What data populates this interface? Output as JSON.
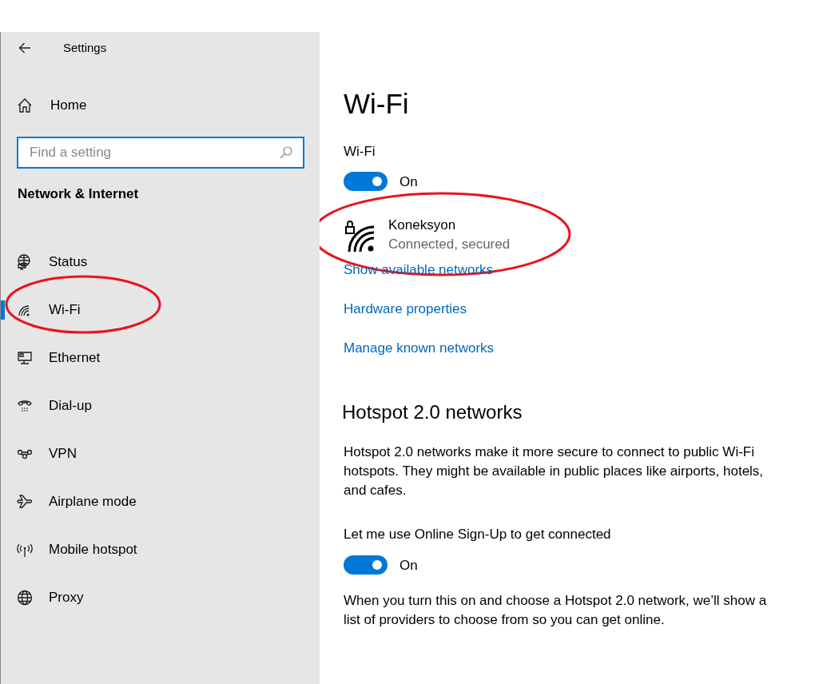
{
  "window": {
    "title": "Settings"
  },
  "sidebar": {
    "home": "Home",
    "search": {
      "placeholder": "Find a setting"
    },
    "section": "Network & Internet",
    "items": [
      {
        "label": "Status",
        "kind": "status",
        "selected": false
      },
      {
        "label": "Wi-Fi",
        "kind": "wifi",
        "selected": true
      },
      {
        "label": "Ethernet",
        "kind": "ethernet",
        "selected": false
      },
      {
        "label": "Dial-up",
        "kind": "dialup",
        "selected": false
      },
      {
        "label": "VPN",
        "kind": "vpn",
        "selected": false
      },
      {
        "label": "Airplane mode",
        "kind": "airplane",
        "selected": false
      },
      {
        "label": "Mobile hotspot",
        "kind": "hotspot",
        "selected": false
      },
      {
        "label": "Proxy",
        "kind": "proxy",
        "selected": false
      }
    ]
  },
  "main": {
    "title": "Wi-Fi",
    "wifi_toggle": {
      "label": "Wi-Fi",
      "on": true,
      "state_text": "On"
    },
    "network": {
      "name": "Koneksyon",
      "status": "Connected, secured"
    },
    "links": [
      "Show available networks",
      "Hardware properties",
      "Manage known networks"
    ],
    "hotspot": {
      "heading": "Hotspot 2.0 networks",
      "description": "Hotspot 2.0 networks make it more secure to connect to public Wi-Fi hotspots. They might be available in public places like airports, hotels, and cafes.",
      "toggle": {
        "label": "Let me use Online Sign-Up to get connected",
        "on": true,
        "state_text": "On"
      },
      "note": "When you turn this on and choose a Hotspot 2.0 network, we’ll show a list of providers to choose from so you can get online."
    }
  }
}
